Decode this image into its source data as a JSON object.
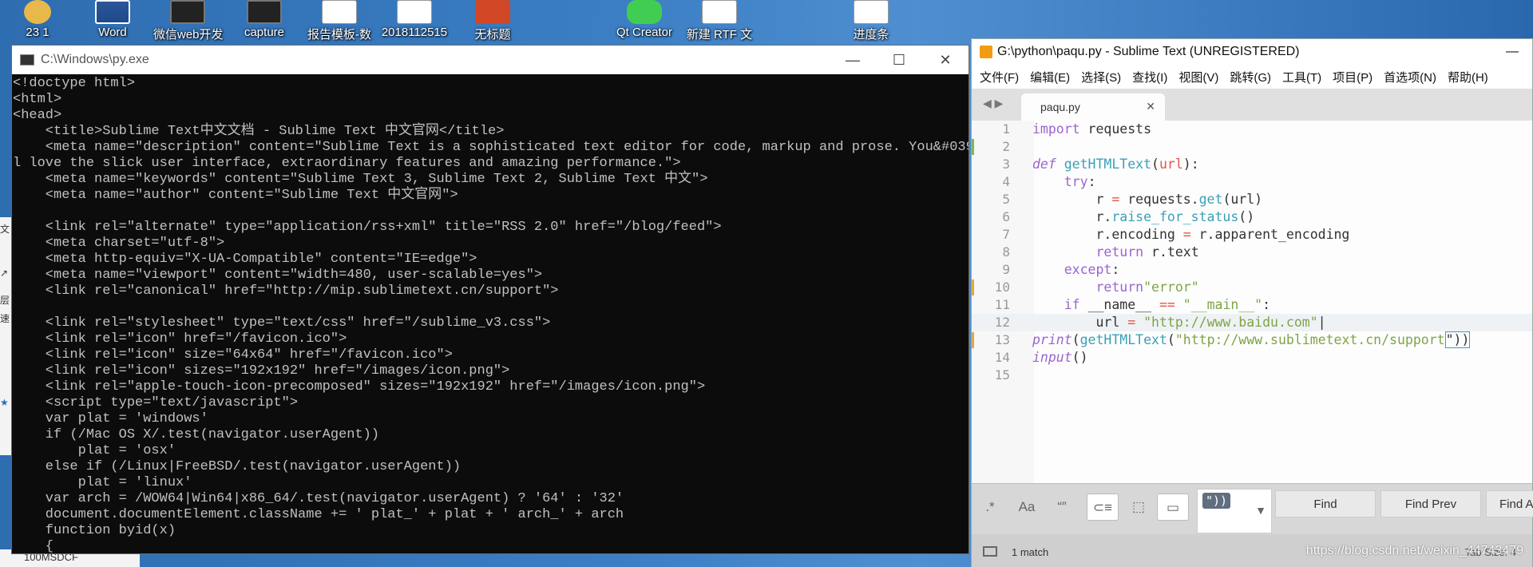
{
  "desktop": {
    "icons": [
      {
        "label": "23 1",
        "icon": "user-icon"
      },
      {
        "label": "Word",
        "icon": "word-icon"
      },
      {
        "label": "微信web开发",
        "icon": "dev-tools-icon"
      },
      {
        "label": "capture",
        "icon": "capture-icon"
      },
      {
        "label": "报告模板-数",
        "icon": "word-doc-icon"
      },
      {
        "label": "2018112515",
        "icon": "word-doc-icon"
      },
      {
        "label": "无标题",
        "icon": "ppt-icon"
      },
      {
        "label": "Qt Creator",
        "icon": "qt-icon"
      },
      {
        "label": "新建 RTF 文",
        "icon": "rtf-icon"
      },
      {
        "label": "进度条",
        "icon": "file-icon"
      }
    ],
    "bottom_label": "100MSDCF",
    "left_strip_chars": [
      "文",
      "↗",
      "层",
      "速",
      "★"
    ],
    "watermark": "https://blog.csdn.net/weixin_44743479"
  },
  "console": {
    "title": "C:\\Windows\\py.exe",
    "lines": [
      "<!doctype html>",
      "<html>",
      "<head>",
      "    <title>Sublime Text中文文档 - Sublime Text 中文官网</title>",
      "    <meta name=\"description\" content=\"Sublime Text is a sophisticated text editor for code, markup and prose. You&#039;l",
      "l love the slick user interface, extraordinary features and amazing performance.\">",
      "    <meta name=\"keywords\" content=\"Sublime Text 3, Sublime Text 2, Sublime Text 中文\">",
      "    <meta name=\"author\" content=\"Sublime Text 中文官网\">",
      "",
      "    <link rel=\"alternate\" type=\"application/rss+xml\" title=\"RSS 2.0\" href=\"/blog/feed\">",
      "    <meta charset=\"utf-8\">",
      "    <meta http-equiv=\"X-UA-Compatible\" content=\"IE=edge\">",
      "    <meta name=\"viewport\" content=\"width=480, user-scalable=yes\">",
      "    <link rel=\"canonical\" href=\"http://mip.sublimetext.cn/support\">",
      "",
      "    <link rel=\"stylesheet\" type=\"text/css\" href=\"/sublime_v3.css\">",
      "    <link rel=\"icon\" href=\"/favicon.ico\">",
      "    <link rel=\"icon\" size=\"64x64\" href=\"/favicon.ico\">",
      "    <link rel=\"icon\" sizes=\"192x192\" href=\"/images/icon.png\">",
      "    <link rel=\"apple-touch-icon-precomposed\" sizes=\"192x192\" href=\"/images/icon.png\">",
      "    <script type=\"text/javascript\">",
      "    var plat = 'windows'",
      "    if (/Mac OS X/.test(navigator.userAgent))",
      "        plat = 'osx'",
      "    else if (/Linux|FreeBSD/.test(navigator.userAgent))",
      "        plat = 'linux'",
      "    var arch = /WOW64|Win64|x86_64/.test(navigator.userAgent) ? '64' : '32'",
      "    document.documentElement.className += ' plat_' + plat + ' arch_' + arch",
      "    function byid(x)",
      "    {"
    ]
  },
  "sublime": {
    "title": "G:\\python\\paqu.py - Sublime Text (UNREGISTERED)",
    "menu": [
      "文件(F)",
      "编辑(E)",
      "选择(S)",
      "查找(I)",
      "视图(V)",
      "跳转(G)",
      "工具(T)",
      "项目(P)",
      "首选项(N)",
      "帮助(H)"
    ],
    "tab": "paqu.py",
    "line_numbers": [
      "1",
      "2",
      "3",
      "4",
      "5",
      "6",
      "7",
      "8",
      "9",
      "10",
      "11",
      "12",
      "13",
      "14",
      "15"
    ],
    "find": {
      "toggles": [
        ".*",
        "Aa",
        "“”",
        "⊂≡",
        "⬚",
        "▭"
      ],
      "query": "\"))",
      "find_label": "Find",
      "find_prev_label": "Find Prev",
      "find_all_label": "Find All"
    },
    "status": {
      "matches": "1 match",
      "tab_size": "Tab Size: 4"
    }
  }
}
